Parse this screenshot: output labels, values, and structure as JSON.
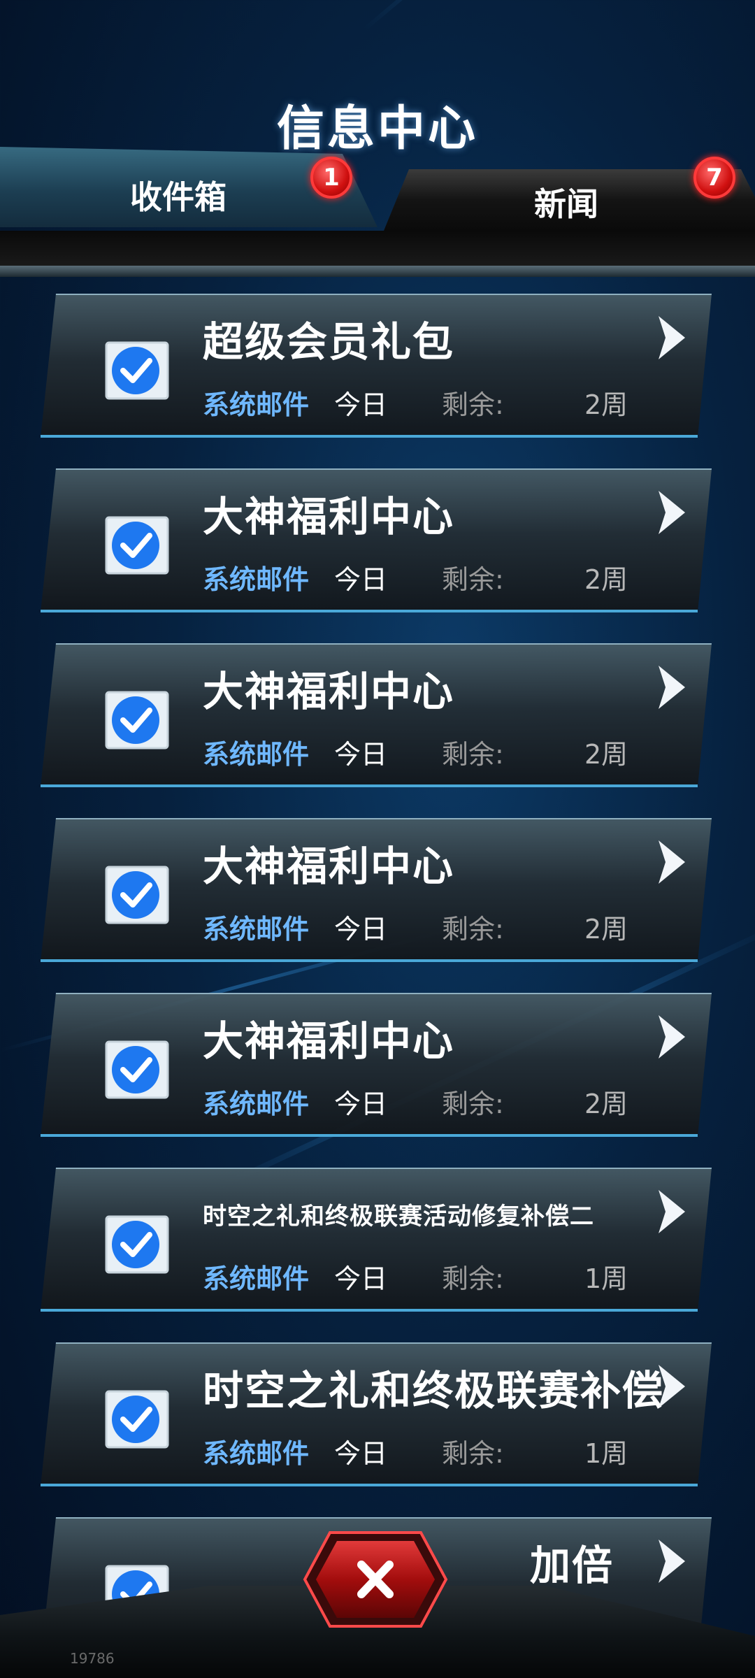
{
  "header": {
    "title": "信息中心"
  },
  "tabs": [
    {
      "label": "收件箱",
      "badge": "1",
      "active": true
    },
    {
      "label": "新闻",
      "badge": "7",
      "active": false
    }
  ],
  "mail_items": [
    {
      "title": "超级会员礼包",
      "sender": "系统邮件",
      "date": "今日",
      "remain_label": "剩余:",
      "remain_value": "2周"
    },
    {
      "title": "大神福利中心",
      "sender": "系统邮件",
      "date": "今日",
      "remain_label": "剩余:",
      "remain_value": "2周"
    },
    {
      "title": "大神福利中心",
      "sender": "系统邮件",
      "date": "今日",
      "remain_label": "剩余:",
      "remain_value": "2周"
    },
    {
      "title": "大神福利中心",
      "sender": "系统邮件",
      "date": "今日",
      "remain_label": "剩余:",
      "remain_value": "2周"
    },
    {
      "title": "大神福利中心",
      "sender": "系统邮件",
      "date": "今日",
      "remain_label": "剩余:",
      "remain_value": "2周"
    },
    {
      "title": "时空之礼和终极联赛活动修复补偿二",
      "sender": "系统邮件",
      "date": "今日",
      "remain_label": "剩余:",
      "remain_value": "1周"
    },
    {
      "title": "时空之礼和终极联赛补偿",
      "sender": "系统邮件",
      "date": "今日",
      "remain_label": "剩余:",
      "remain_value": "1周"
    },
    {
      "title": "加倍",
      "sender": "",
      "date": "",
      "remain_label": "",
      "remain_value": ""
    }
  ],
  "footer": {
    "code": "19786",
    "close_icon": "close-x-icon"
  },
  "colors": {
    "accent": "#6fb8ff",
    "badge": "#e01818",
    "tab_active_edge": "#5fd4ff"
  }
}
